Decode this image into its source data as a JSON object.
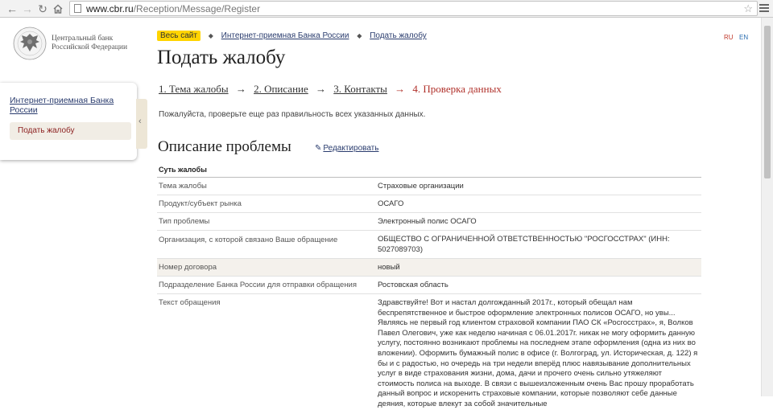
{
  "browser": {
    "url_host": "www.cbr.ru",
    "url_path": "/Reception/Message/Register",
    "back_icon": "arrow-left-icon",
    "forward_icon": "arrow-right-icon",
    "reload_icon": "reload-icon",
    "home_icon": "home-icon",
    "star_icon": "star-icon",
    "menu_icon": "hamburger-menu-icon"
  },
  "logo": {
    "line1": "Центральный банк",
    "line2": "Российской Федерации",
    "emblem_icon": "double-headed-eagle-icon"
  },
  "lang": {
    "ru": "RU",
    "en": "EN"
  },
  "breadcrumb": {
    "badge": "Весь сайт",
    "items": [
      "Интернет-приемная Банка России",
      "Подать жалобу"
    ]
  },
  "page_title": "Подать жалобу",
  "steps": {
    "step1": "1. Тема жалобы",
    "step2": "2. Описание",
    "step3": "3. Контакты",
    "step4": "4. Проверка данных",
    "arrow": "→"
  },
  "note": "Пожалуйста, проверьте еще раз правильность всех указанных данных.",
  "sidebar": {
    "link": "Интернет-приемная Банка России",
    "active": "Подать жалобу",
    "collapse_icon": "chevron-left-icon"
  },
  "section": {
    "title": "Описание проблемы",
    "edit_label": "Редактировать",
    "edit_icon": "pencil-icon"
  },
  "table": {
    "header": "Суть жалобы",
    "rows": [
      {
        "key": "Тема жалобы",
        "value": "Страховые организации"
      },
      {
        "key": "Продукт/субъект рынка",
        "value": "ОСАГО"
      },
      {
        "key": "Тип проблемы",
        "value": "Электронный полис ОСАГО"
      },
      {
        "key": "Организация, с которой связано Ваше обращение",
        "value": "ОБЩЕСТВО С ОГРАНИЧЕННОЙ ОТВЕТСТВЕННОСТЬЮ \"РОСГОССТРАХ\" (ИНН: 5027089703)"
      },
      {
        "key": "Номер договора",
        "value": "новый"
      },
      {
        "key": "Подразделение Банка России для отправки обращения",
        "value": "Ростовская область"
      },
      {
        "key": "Текст обращения",
        "value": "Здравствуйте! Вот и настал долгожданный 2017г., который обещал нам беспрепятственное и быстрое оформление электронных полисов ОСАГО, но увы... Являясь не первый год клиентом страховой компании ПАО СК «Росгосстрах», я, Волков Павел Олегович, уже как неделю начиная с 06.01.2017г. никак не могу оформить данную услугу, постоянно возникают проблемы на последнем этапе оформления (одна из них во вложении). Оформить бумажный полис в офисе (г. Волгоград, ул. Историческая, д. 122) я бы и с радостью, но очередь на три недели вперёд плюс навязывание дополнительных услуг в виде страхования жизни, дома, дачи и прочего очень сильно утяжеляют стоимость полиса на выходе. В связи с вышеизложенным очень Вас прошу проработать данный вопрос и искоренить страховые компании, которые позволяют себе данные деяния, которые влекут за собой значительные"
      }
    ]
  }
}
